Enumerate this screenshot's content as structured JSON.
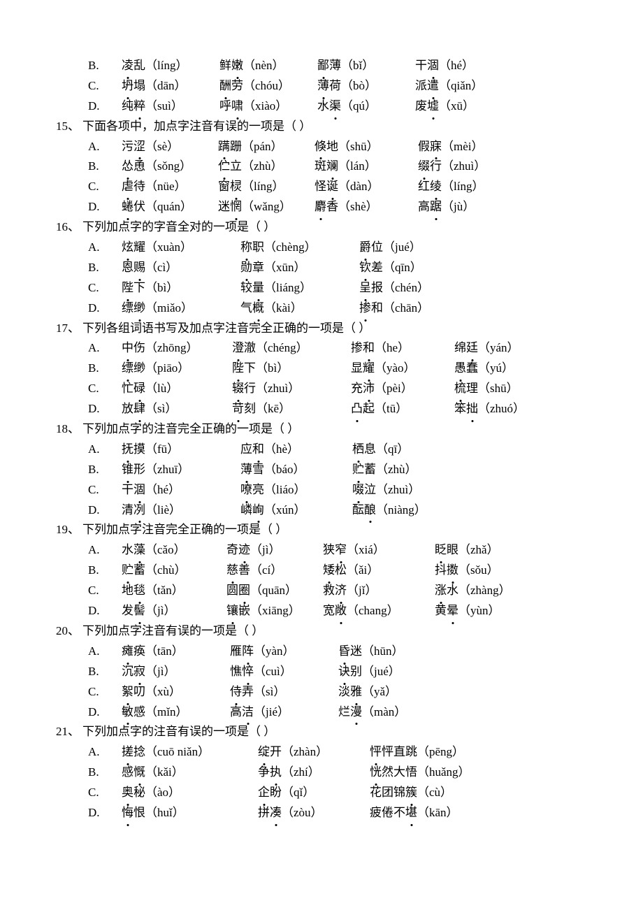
{
  "extra_options": {
    "rows": [
      {
        "label": "B.",
        "words": [
          "凌乱（líng）",
          "鲜嫩（nèn）",
          "鄙薄（bǐ）",
          "干涸（hé）"
        ],
        "widths": [
          140,
          140,
          140,
          140
        ],
        "dot": [
          0,
          1,
          0,
          1
        ]
      },
      {
        "label": "C.",
        "words": [
          "坍塌（dān）",
          "酬劳（chóu）",
          "薄荷（bò）",
          "派遣（qiǎn）"
        ],
        "widths": [
          140,
          140,
          140,
          140
        ],
        "dot": [
          0,
          0,
          0,
          1
        ]
      },
      {
        "label": "D.",
        "words": [
          "纯粹（suì）",
          "呼啸（xiào）",
          "水渠（qú）",
          "废墟（xū）"
        ],
        "widths": [
          140,
          140,
          140,
          140
        ],
        "dot": [
          1,
          1,
          1,
          1
        ]
      }
    ]
  },
  "questions": [
    {
      "num": "15、",
      "stem": "下面各项中，加点字注音有误的一项是（   ）",
      "options": [
        {
          "label": "A.",
          "words": [
            "污涩（sè）",
            "蹒跚（pán）",
            "倏地（shū）",
            "假寐（mèi）"
          ],
          "widths": [
            138,
            138,
            148,
            150
          ],
          "dot": [
            1,
            0,
            0,
            1
          ]
        },
        {
          "label": "B.",
          "words": [
            "怂恿（sǒng）",
            "伫立（zhù）",
            "斑斓（lán）",
            "缀行（zhuì）"
          ],
          "widths": [
            138,
            138,
            148,
            150
          ],
          "dot": [
            0,
            0,
            1,
            0
          ]
        },
        {
          "label": "C.",
          "words": [
            "虐待（nüe）",
            "窗棂（líng）",
            "怪诞（dàn）",
            "红绫（líng）"
          ],
          "widths": [
            138,
            138,
            148,
            150
          ],
          "dot": [
            0,
            1,
            1,
            1
          ]
        },
        {
          "label": "D.",
          "words": [
            "蜷伏（quán）",
            "迷惘（wǎng）",
            "麝香（shè）",
            "高踞（jù）"
          ],
          "widths": [
            138,
            138,
            148,
            150
          ],
          "dot": [
            0,
            1,
            0,
            1
          ]
        }
      ]
    },
    {
      "num": "16、",
      "stem": "下列加点字的字音全对的一项是（   ）",
      "options": [
        {
          "label": "A.",
          "words": [
            "炫耀（xuàn）",
            "称职（chèng）",
            "爵位（jué）"
          ],
          "widths": [
            170,
            170,
            170
          ],
          "dot": [
            0,
            0,
            0
          ]
        },
        {
          "label": "B.",
          "words": [
            "恩赐（cì）",
            "勋章（xūn）",
            "钦差（qīn）"
          ],
          "widths": [
            170,
            170,
            170
          ],
          "dot": [
            1,
            0,
            0
          ]
        },
        {
          "label": "C.",
          "words": [
            "陛下（bì）",
            "较量（liáng）",
            "呈报（chén）"
          ],
          "widths": [
            170,
            170,
            170
          ],
          "dot": [
            0,
            1,
            0
          ]
        },
        {
          "label": "D.",
          "words": [
            "缥缈（miǎo）",
            "气概（kài）",
            "掺和（chān）"
          ],
          "widths": [
            170,
            170,
            170
          ],
          "dot": [
            1,
            1,
            0
          ]
        }
      ]
    },
    {
      "num": "17、",
      "stem": "下列各组词语书写及加点字注音完全正确的一项是（   ）",
      "options": [
        {
          "label": "A.",
          "words": [
            "中伤（zhōng）",
            "澄澈（chéng）",
            "掺和（he）",
            "绵廷（yán）"
          ],
          "widths": [
            158,
            170,
            148,
            140
          ],
          "dot": [
            0,
            0,
            1,
            1
          ]
        },
        {
          "label": "B.",
          "words": [
            "缥缈（piāo）",
            "陛下（bì）",
            "显耀（yào）",
            "愚蠢（yú）"
          ],
          "widths": [
            158,
            170,
            148,
            140
          ],
          "dot": [
            0,
            0,
            1,
            0
          ]
        },
        {
          "label": "C.",
          "words": [
            "忙碌（lù）",
            "辍行（zhuì）",
            "充沛（pèi）",
            "梳理（shū）"
          ],
          "widths": [
            158,
            170,
            148,
            140
          ],
          "dot": [
            1,
            0,
            1,
            0
          ]
        },
        {
          "label": "D.",
          "words": [
            "放肆（sì）",
            "苛刻（kē）",
            "凸起（tū）",
            "笨拙（zhuó）"
          ],
          "widths": [
            158,
            170,
            148,
            140
          ],
          "dot": [
            1,
            0,
            0,
            1
          ]
        }
      ]
    },
    {
      "num": "18、",
      "stem": "下列加点字的注音完全正确的一项是（   ）",
      "options": [
        {
          "label": "A.",
          "words": [
            "抚摸（fū）",
            "应和（hè）",
            "栖息（qī）"
          ],
          "widths": [
            170,
            160,
            160
          ],
          "dot": [
            0,
            1,
            0
          ]
        },
        {
          "label": "B.",
          "words": [
            "锥形（zhuī）",
            "薄雪（báo）",
            "贮蓄（zhù）"
          ],
          "widths": [
            170,
            160,
            160
          ],
          "dot": [
            0,
            0,
            0
          ]
        },
        {
          "label": "C.",
          "words": [
            "干涸（hé）",
            "嘹亮（liáo）",
            "啜泣（zhuì）"
          ],
          "widths": [
            170,
            160,
            160
          ],
          "dot": [
            1,
            0,
            0
          ]
        },
        {
          "label": "D.",
          "words": [
            "清冽（liè）",
            "嶙峋（xún）",
            "酝酿（niàng）"
          ],
          "widths": [
            170,
            160,
            160
          ],
          "dot": [
            1,
            1,
            1
          ]
        }
      ]
    },
    {
      "num": "19、",
      "stem": "下列加点字注音完全正确的一项是（   ）",
      "options": [
        {
          "label": "A.",
          "words": [
            "水藻（cǎo）",
            "奇迹（jì）",
            "狭窄（xiá）",
            "眨眼（zhǎ）"
          ],
          "widths": [
            150,
            138,
            160,
            150
          ],
          "dot": [
            1,
            1,
            1,
            0
          ]
        },
        {
          "label": "B.",
          "words": [
            "贮蓄（chù）",
            "慈善（cí）",
            "矮松（ǎi）",
            "抖擞（sǒu）"
          ],
          "widths": [
            150,
            138,
            160,
            150
          ],
          "dot": [
            0,
            0,
            0,
            1
          ]
        },
        {
          "label": "C.",
          "words": [
            "地毯（tǎn）",
            "圆圈（quān）",
            "救济（jǐ）",
            "涨水（zhàng）"
          ],
          "widths": [
            150,
            138,
            160,
            150
          ],
          "dot": [
            1,
            1,
            1,
            0
          ]
        },
        {
          "label": "D.",
          "words": [
            "发髻（jì）",
            "镶嵌（xiāng）",
            "宽敞（chang）",
            "黄晕（yùn）"
          ],
          "widths": [
            150,
            138,
            160,
            150
          ],
          "dot": [
            1,
            0,
            1,
            1
          ]
        }
      ]
    },
    {
      "num": "20、",
      "stem": "下列加点字注音有误的一项是（   ）",
      "options": [
        {
          "label": "A.",
          "words": [
            "瘫痪（tān）",
            "雁阵（yàn）",
            "昏迷（hūn）"
          ],
          "widths": [
            155,
            155,
            155
          ],
          "dot": [
            0,
            1,
            0
          ]
        },
        {
          "label": "B.",
          "words": [
            "沉寂（jì）",
            "憔悴（cuì）",
            "诀别（jué）"
          ],
          "widths": [
            155,
            155,
            155
          ],
          "dot": [
            1,
            1,
            0
          ]
        },
        {
          "label": "C.",
          "words": [
            "絮叨（xù）",
            "侍弄（sì）",
            "淡雅（yǎ）"
          ],
          "widths": [
            155,
            155,
            155
          ],
          "dot": [
            0,
            0,
            1
          ]
        },
        {
          "label": "D.",
          "words": [
            "敏感（mǐn）",
            "高洁（jié）",
            "烂漫（màn）"
          ],
          "widths": [
            155,
            155,
            155
          ],
          "dot": [
            0,
            1,
            1
          ]
        }
      ]
    },
    {
      "num": "21、",
      "stem": "下列加点字的注音有误的一项是（   ）",
      "options": [
        {
          "label": "A.",
          "words": [
            "搓捻（cuō niǎn）",
            "绽开（zhàn）",
            "怦怦直跳（pēng）"
          ],
          "widths": [
            195,
            160,
            200
          ],
          "dot": [
            0,
            0,
            0
          ]
        },
        {
          "label": "B.",
          "words": [
            "感慨（kǎi）",
            "争执（zhí）",
            "恍然大悟（huǎng）"
          ],
          "widths": [
            195,
            160,
            200
          ],
          "dot": [
            1,
            1,
            0
          ]
        },
        {
          "label": "C.",
          "words": [
            "奥秘（ào）",
            "企盼（qǐ）",
            "花团锦簇（cù）"
          ],
          "widths": [
            195,
            160,
            200
          ],
          "dot": [
            0,
            0,
            3
          ]
        },
        {
          "label": "D.",
          "words": [
            "悔恨（huǐ）",
            "拼凑（zòu）",
            "疲倦不堪（kān）"
          ],
          "widths": [
            195,
            160,
            200
          ],
          "dot": [
            0,
            1,
            3
          ]
        }
      ]
    }
  ]
}
